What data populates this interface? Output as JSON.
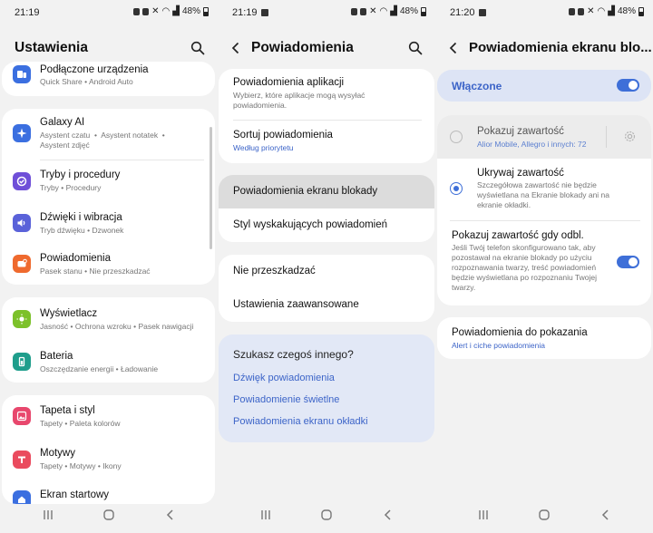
{
  "screens": [
    {
      "status": {
        "time": "21:19",
        "battery": "48%"
      },
      "title": "Ustawienia",
      "groups": [
        [
          {
            "title": "Podłączone urządzenia",
            "sub": "Quick Share  •  Android Auto",
            "icon": "connected-devices-icon",
            "color": "#3b6fe0"
          }
        ],
        [
          {
            "title": "Galaxy AI",
            "sub": "Asystent czatu  •  Asystent notatek  •\nAsystent zdjęć",
            "icon": "galaxy-ai-icon",
            "color": "#3b6fe0"
          },
          {
            "title": "Tryby i procedury",
            "sub": "Tryby  •  Procedury",
            "icon": "modes-routines-icon",
            "color": "#6f4fd8"
          },
          {
            "title": "Dźwięki i wibracja",
            "sub": "Tryb dźwięku  •  Dzwonek",
            "icon": "sound-icon",
            "color": "#5a62d9"
          },
          {
            "title": "Powiadomienia",
            "sub": "Pasek stanu  •  Nie przeszkadzać",
            "icon": "notifications-icon",
            "color": "#ef6a2e"
          }
        ],
        [
          {
            "title": "Wyświetlacz",
            "sub": "Jasność  •  Ochrona wzroku  •  Pasek nawigacji",
            "icon": "display-icon",
            "color": "#7cc12a"
          },
          {
            "title": "Bateria",
            "sub": "Oszczędzanie energii  •  Ładowanie",
            "icon": "battery-icon",
            "color": "#1f9e8c"
          }
        ],
        [
          {
            "title": "Tapeta i styl",
            "sub": "Tapety  •  Paleta kolorów",
            "icon": "wallpaper-icon",
            "color": "#e8476d"
          },
          {
            "title": "Motywy",
            "sub": "Tapety  •  Motywy  •  Ikony",
            "icon": "themes-icon",
            "color": "#ea4b5e"
          },
          {
            "title": "Ekran startowy",
            "sub": "",
            "icon": "home-screen-icon",
            "color": "#3b6fe0"
          }
        ]
      ]
    },
    {
      "status": {
        "time": "21:19",
        "battery": "48%"
      },
      "title": "Powiadomienia",
      "app_notif": {
        "title": "Powiadomienia aplikacji",
        "sub": "Wybierz, które aplikacje mogą wysyłać\npowiadomienia."
      },
      "sort": {
        "title": "Sortuj powiadomienia",
        "sub": "Według priorytetu"
      },
      "lock": {
        "title": "Powiadomienia ekranu blokady"
      },
      "popup": {
        "title": "Styl wyskakujących powiadomień"
      },
      "dnd": {
        "title": "Nie przeszkadzać"
      },
      "advanced": {
        "title": "Ustawienia zaawansowane"
      },
      "looking": {
        "title": "Szukasz czegoś innego?",
        "links": [
          "Dźwięk powiadomienia",
          "Powiadomienie świetlne",
          "Powiadomienia ekranu okładki"
        ]
      }
    },
    {
      "status": {
        "time": "21:20",
        "battery": "48%"
      },
      "title": "Powiadomienia ekranu blo...",
      "enabled": {
        "label": "Włączone",
        "on": true
      },
      "show": {
        "title": "Pokazuj zawartość",
        "sub": "Alior Mobile, Allegro i innych: 72"
      },
      "hide": {
        "title": "Ukrywaj zawartość",
        "sub": "Szczegółowa zawartość nie będzie\nwyświetlana na Ekranie blokady ani na\nekranie okładki."
      },
      "unlock": {
        "title": "Pokazuj zawartość gdy odbl.",
        "sub": "Jeśli Twój telefon skonfigurowano tak, aby\npozostawał na ekranie blokady po użyciu\nrozpoznawania twarzy, treść powiadomień\nbędzie wyświetlana po rozpoznaniu Twojej\ntwarzy.",
        "on": true
      },
      "toshow": {
        "title": "Powiadomienia do pokazania",
        "sub": "Alert i ciche powiadomienia"
      }
    }
  ]
}
